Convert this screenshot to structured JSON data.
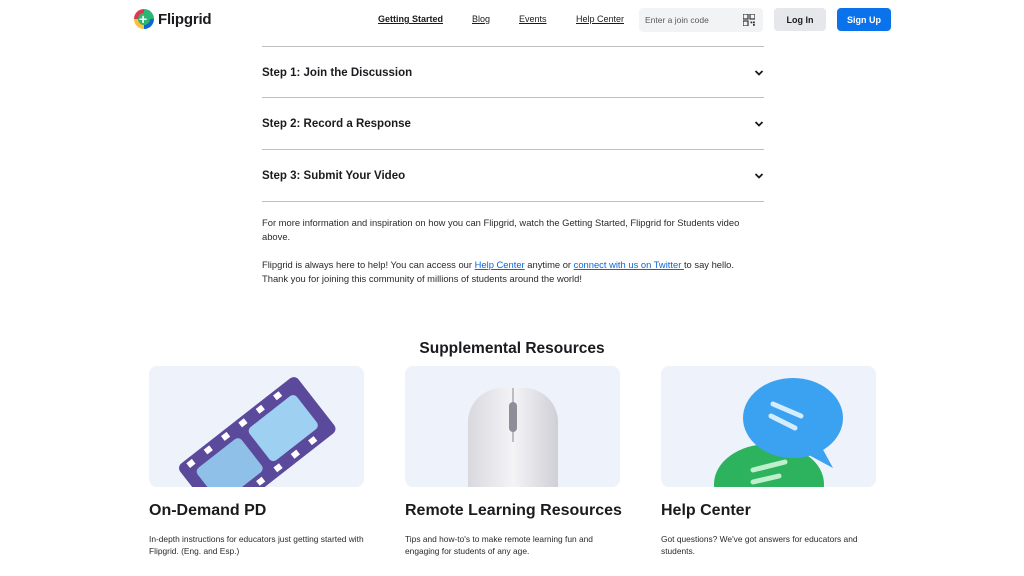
{
  "header": {
    "logo_text": "Flipgrid",
    "nav": [
      {
        "label": "Getting Started"
      },
      {
        "label": "Blog"
      },
      {
        "label": "Events"
      },
      {
        "label": "Help Center"
      }
    ],
    "join_placeholder": "Enter a join code",
    "login_label": "Log In",
    "signup_label": "Sign Up"
  },
  "accordion": {
    "items": [
      {
        "title": "Step 1: Join the Discussion"
      },
      {
        "title": "Step 2: Record a Response"
      },
      {
        "title": "Step 3: Submit Your Video"
      }
    ]
  },
  "info": {
    "p1": "For more information and inspiration on how you can Flipgrid, watch the Getting Started, Flipgrid for Students video above.",
    "p2_before": "Flipgrid is always here to help! You can access our ",
    "p2_link1": "Help Center",
    "p2_middle": " anytime or ",
    "p2_link2": "connect with us on Twitter ",
    "p2_after": "to say hello. Thank you for joining this community of millions of students around the world!"
  },
  "resources": {
    "title": "Supplemental Resources",
    "cards": [
      {
        "title": "On-Demand PD",
        "desc": "In-depth instructions for educators just getting started with Flipgrid. (Eng. and  Esp.)",
        "icon": "film-strip-icon"
      },
      {
        "title": "Remote Learning Resources",
        "desc": "Tips and how-to's to make remote learning fun and engaging for students of any age.",
        "icon": "mouse-icon"
      },
      {
        "title": "Help Center",
        "desc": "Got questions? We've got answers for educators and students.",
        "icon": "chat-bubbles-icon"
      }
    ]
  },
  "colors": {
    "primary": "#0a73eb",
    "link": "#0a66d9",
    "card_bg": "#eef2fb"
  }
}
